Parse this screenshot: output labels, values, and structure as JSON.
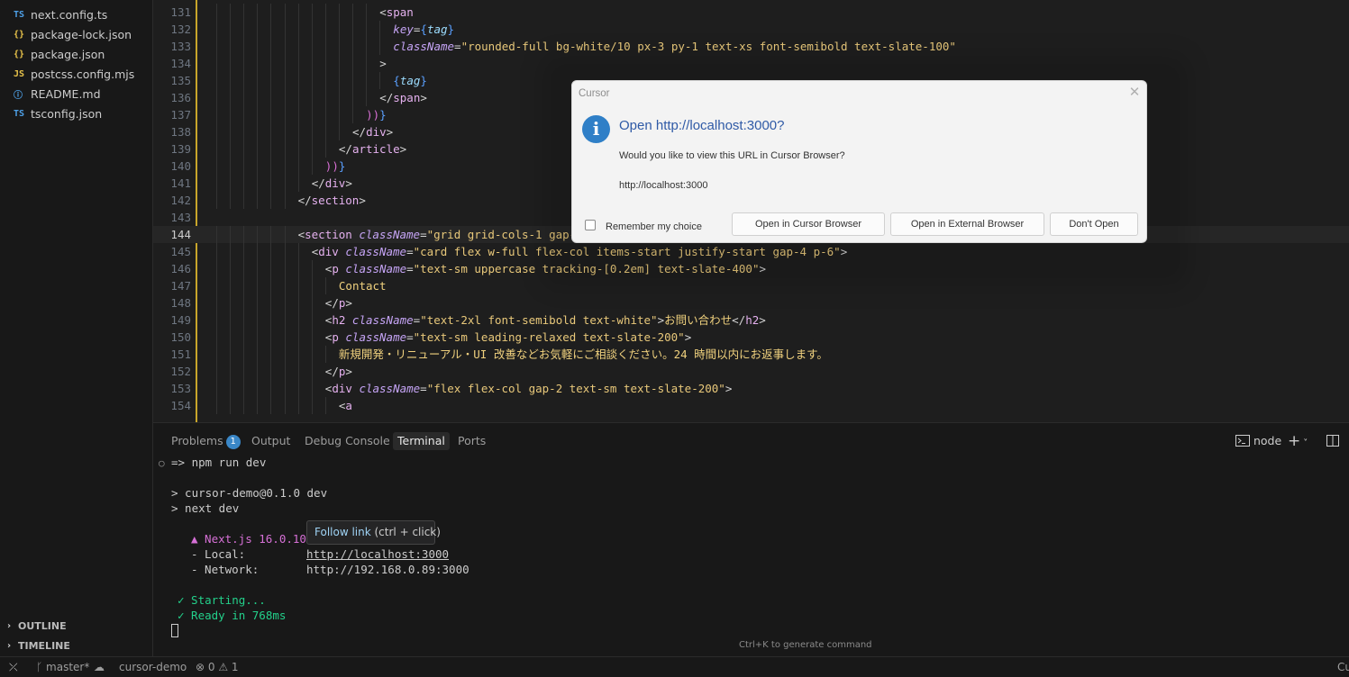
{
  "explorer": {
    "files": [
      {
        "icon": "TS",
        "icon_color": "#4ea1e8",
        "name": "next.config.ts"
      },
      {
        "icon": "{}",
        "icon_color": "#e8c34a",
        "name": "package-lock.json"
      },
      {
        "icon": "{}",
        "icon_color": "#e8c34a",
        "name": "package.json"
      },
      {
        "icon": "JS",
        "icon_color": "#e8c34a",
        "name": "postcss.config.mjs"
      },
      {
        "icon": "ⓘ",
        "icon_color": "#4ea1e8",
        "name": "README.md"
      },
      {
        "icon": "TS",
        "icon_color": "#4ea1e8",
        "name": "tsconfig.json"
      }
    ],
    "sections": [
      {
        "chevron": "›",
        "label": "OUTLINE"
      },
      {
        "chevron": "›",
        "label": "TIMELINE"
      }
    ]
  },
  "editor": {
    "active_line": "144",
    "lines": [
      {
        "n": "131",
        "indent": 12,
        "tokens": [
          [
            "t-punc",
            "<"
          ],
          [
            "t-tag",
            "span"
          ]
        ]
      },
      {
        "n": "132",
        "indent": 13,
        "tokens": [
          [
            "t-attr",
            "key"
          ],
          [
            "t-punc",
            "="
          ],
          [
            "t-brack2",
            "{"
          ],
          [
            "t-var",
            "tag"
          ],
          [
            "t-brack2",
            "}"
          ]
        ]
      },
      {
        "n": "133",
        "indent": 13,
        "tokens": [
          [
            "t-attr",
            "className"
          ],
          [
            "t-punc",
            "="
          ],
          [
            "t-str",
            "\"rounded-full bg-white/10 px-3 py-1 text-xs font-semibold text-slate-100\""
          ]
        ]
      },
      {
        "n": "134",
        "indent": 12,
        "tokens": [
          [
            "t-punc",
            ">"
          ]
        ]
      },
      {
        "n": "135",
        "indent": 13,
        "tokens": [
          [
            "t-brack2",
            "{"
          ],
          [
            "t-var",
            "tag"
          ],
          [
            "t-brack2",
            "}"
          ]
        ]
      },
      {
        "n": "136",
        "indent": 12,
        "tokens": [
          [
            "t-punc",
            "</"
          ],
          [
            "t-tag",
            "span"
          ],
          [
            "t-punc",
            ">"
          ]
        ]
      },
      {
        "n": "137",
        "indent": 11,
        "tokens": [
          [
            "t-brack",
            "))"
          ],
          [
            "t-brack2",
            "}"
          ]
        ]
      },
      {
        "n": "138",
        "indent": 10,
        "tokens": [
          [
            "t-punc",
            "</"
          ],
          [
            "t-tag",
            "div"
          ],
          [
            "t-punc",
            ">"
          ]
        ]
      },
      {
        "n": "139",
        "indent": 9,
        "tokens": [
          [
            "t-punc",
            "</"
          ],
          [
            "t-tag",
            "article"
          ],
          [
            "t-punc",
            ">"
          ]
        ]
      },
      {
        "n": "140",
        "indent": 8,
        "tokens": [
          [
            "t-brack",
            "))"
          ],
          [
            "t-brack2",
            "}"
          ]
        ]
      },
      {
        "n": "141",
        "indent": 7,
        "tokens": [
          [
            "t-punc",
            "</"
          ],
          [
            "t-tag",
            "div"
          ],
          [
            "t-punc",
            ">"
          ]
        ]
      },
      {
        "n": "142",
        "indent": 6,
        "tokens": [
          [
            "t-punc",
            "</"
          ],
          [
            "t-tag",
            "section"
          ],
          [
            "t-punc",
            ">"
          ]
        ]
      },
      {
        "n": "143",
        "indent": 0,
        "tokens": []
      },
      {
        "n": "144",
        "indent": 6,
        "tokens": [
          [
            "t-punc",
            "<"
          ],
          [
            "t-tag",
            "section"
          ],
          [
            "t-punc",
            " "
          ],
          [
            "t-attr",
            "className"
          ],
          [
            "t-punc",
            "="
          ],
          [
            "t-str",
            "\"grid grid-cols-1 gap-6\""
          ],
          [
            "t-punc",
            ">"
          ]
        ]
      },
      {
        "n": "145",
        "indent": 7,
        "tokens": [
          [
            "t-punc",
            "<"
          ],
          [
            "t-tag",
            "div"
          ],
          [
            "t-punc",
            " "
          ],
          [
            "t-attr",
            "className"
          ],
          [
            "t-punc",
            "="
          ],
          [
            "t-str",
            "\"card flex w-full flex-col items-start justify-start gap-4 p-6\""
          ],
          [
            "t-punc",
            ">"
          ]
        ]
      },
      {
        "n": "146",
        "indent": 8,
        "tokens": [
          [
            "t-punc",
            "<"
          ],
          [
            "t-tag",
            "p"
          ],
          [
            "t-punc",
            " "
          ],
          [
            "t-attr",
            "className"
          ],
          [
            "t-punc",
            "="
          ],
          [
            "t-str",
            "\"text-sm uppercase tracking-[0.2em] text-slate-400\""
          ],
          [
            "t-punc",
            ">"
          ]
        ]
      },
      {
        "n": "147",
        "indent": 9,
        "tokens": [
          [
            "t-text",
            "Contact"
          ]
        ]
      },
      {
        "n": "148",
        "indent": 8,
        "tokens": [
          [
            "t-punc",
            "</"
          ],
          [
            "t-tag",
            "p"
          ],
          [
            "t-punc",
            ">"
          ]
        ]
      },
      {
        "n": "149",
        "indent": 8,
        "tokens": [
          [
            "t-punc",
            "<"
          ],
          [
            "t-tag",
            "h2"
          ],
          [
            "t-punc",
            " "
          ],
          [
            "t-attr",
            "className"
          ],
          [
            "t-punc",
            "="
          ],
          [
            "t-str",
            "\"text-2xl font-semibold text-white\""
          ],
          [
            "t-punc",
            ">"
          ],
          [
            "t-text",
            "お問い合わせ"
          ],
          [
            "t-punc",
            "</"
          ],
          [
            "t-tag",
            "h2"
          ],
          [
            "t-punc",
            ">"
          ]
        ]
      },
      {
        "n": "150",
        "indent": 8,
        "tokens": [
          [
            "t-punc",
            "<"
          ],
          [
            "t-tag",
            "p"
          ],
          [
            "t-punc",
            " "
          ],
          [
            "t-attr",
            "className"
          ],
          [
            "t-punc",
            "="
          ],
          [
            "t-str",
            "\"text-sm leading-relaxed text-slate-200\""
          ],
          [
            "t-punc",
            ">"
          ]
        ]
      },
      {
        "n": "151",
        "indent": 9,
        "tokens": [
          [
            "t-text",
            "新規開発・リニューアル・UI 改善などお気軽にご相談ください。24 時間以内にお返事します。"
          ]
        ]
      },
      {
        "n": "152",
        "indent": 8,
        "tokens": [
          [
            "t-punc",
            "</"
          ],
          [
            "t-tag",
            "p"
          ],
          [
            "t-punc",
            ">"
          ]
        ]
      },
      {
        "n": "153",
        "indent": 8,
        "tokens": [
          [
            "t-punc",
            "<"
          ],
          [
            "t-tag",
            "div"
          ],
          [
            "t-punc",
            " "
          ],
          [
            "t-attr",
            "className"
          ],
          [
            "t-punc",
            "="
          ],
          [
            "t-str",
            "\"flex flex-col gap-2 text-sm text-slate-200\""
          ],
          [
            "t-punc",
            ">"
          ]
        ]
      },
      {
        "n": "154",
        "indent": 9,
        "tokens": [
          [
            "t-punc",
            "<"
          ],
          [
            "t-tag",
            "a"
          ]
        ]
      }
    ]
  },
  "panel": {
    "tabs": [
      {
        "label": "Problems",
        "badge": "1"
      },
      {
        "label": "Output"
      },
      {
        "label": "Debug Console"
      },
      {
        "label": "Terminal",
        "active": true
      },
      {
        "label": "Ports"
      }
    ],
    "terminal_label": "node",
    "add_icon": "+",
    "chevron": "˅",
    "terminal_lines": {
      "prompt_marker": "○",
      "cmd": "=> npm run dev",
      "out1": "> cursor-demo@0.1.0 dev",
      "out2": "> next dev",
      "nextjs": "▲ Next.js 16.0.10",
      "local_label": "- Local:",
      "local_url": "http://localhost:3000",
      "network_label": "- Network:",
      "network_url": "http://192.168.0.89:3000",
      "starting": "✓ Starting...",
      "ready": "✓ Ready in 768ms"
    },
    "hint": "Ctrl+K to generate command"
  },
  "tooltip": {
    "link": "Follow link",
    "rest": " (ctrl + click)"
  },
  "dialog": {
    "title": "Cursor",
    "close_glyph": "✕",
    "info_glyph": "i",
    "heading": "Open http://localhost:3000?",
    "message": "Would you like to view this URL in Cursor Browser?",
    "detail": "http://localhost:3000",
    "checkbox_label": "Remember my choice",
    "btn_cursor": "Open in Cursor Browser",
    "btn_external": "Open in External Browser",
    "btn_dont": "Don't Open"
  },
  "statusbar": {
    "remote_glyph": "⤫",
    "branch": "master*",
    "branch_glyph": "ᚴ",
    "sync_glyph": "☁",
    "project": "cursor-demo",
    "errors": "⊗ 0",
    "warnings": "⚠ 1",
    "right_cut": "Cu"
  }
}
